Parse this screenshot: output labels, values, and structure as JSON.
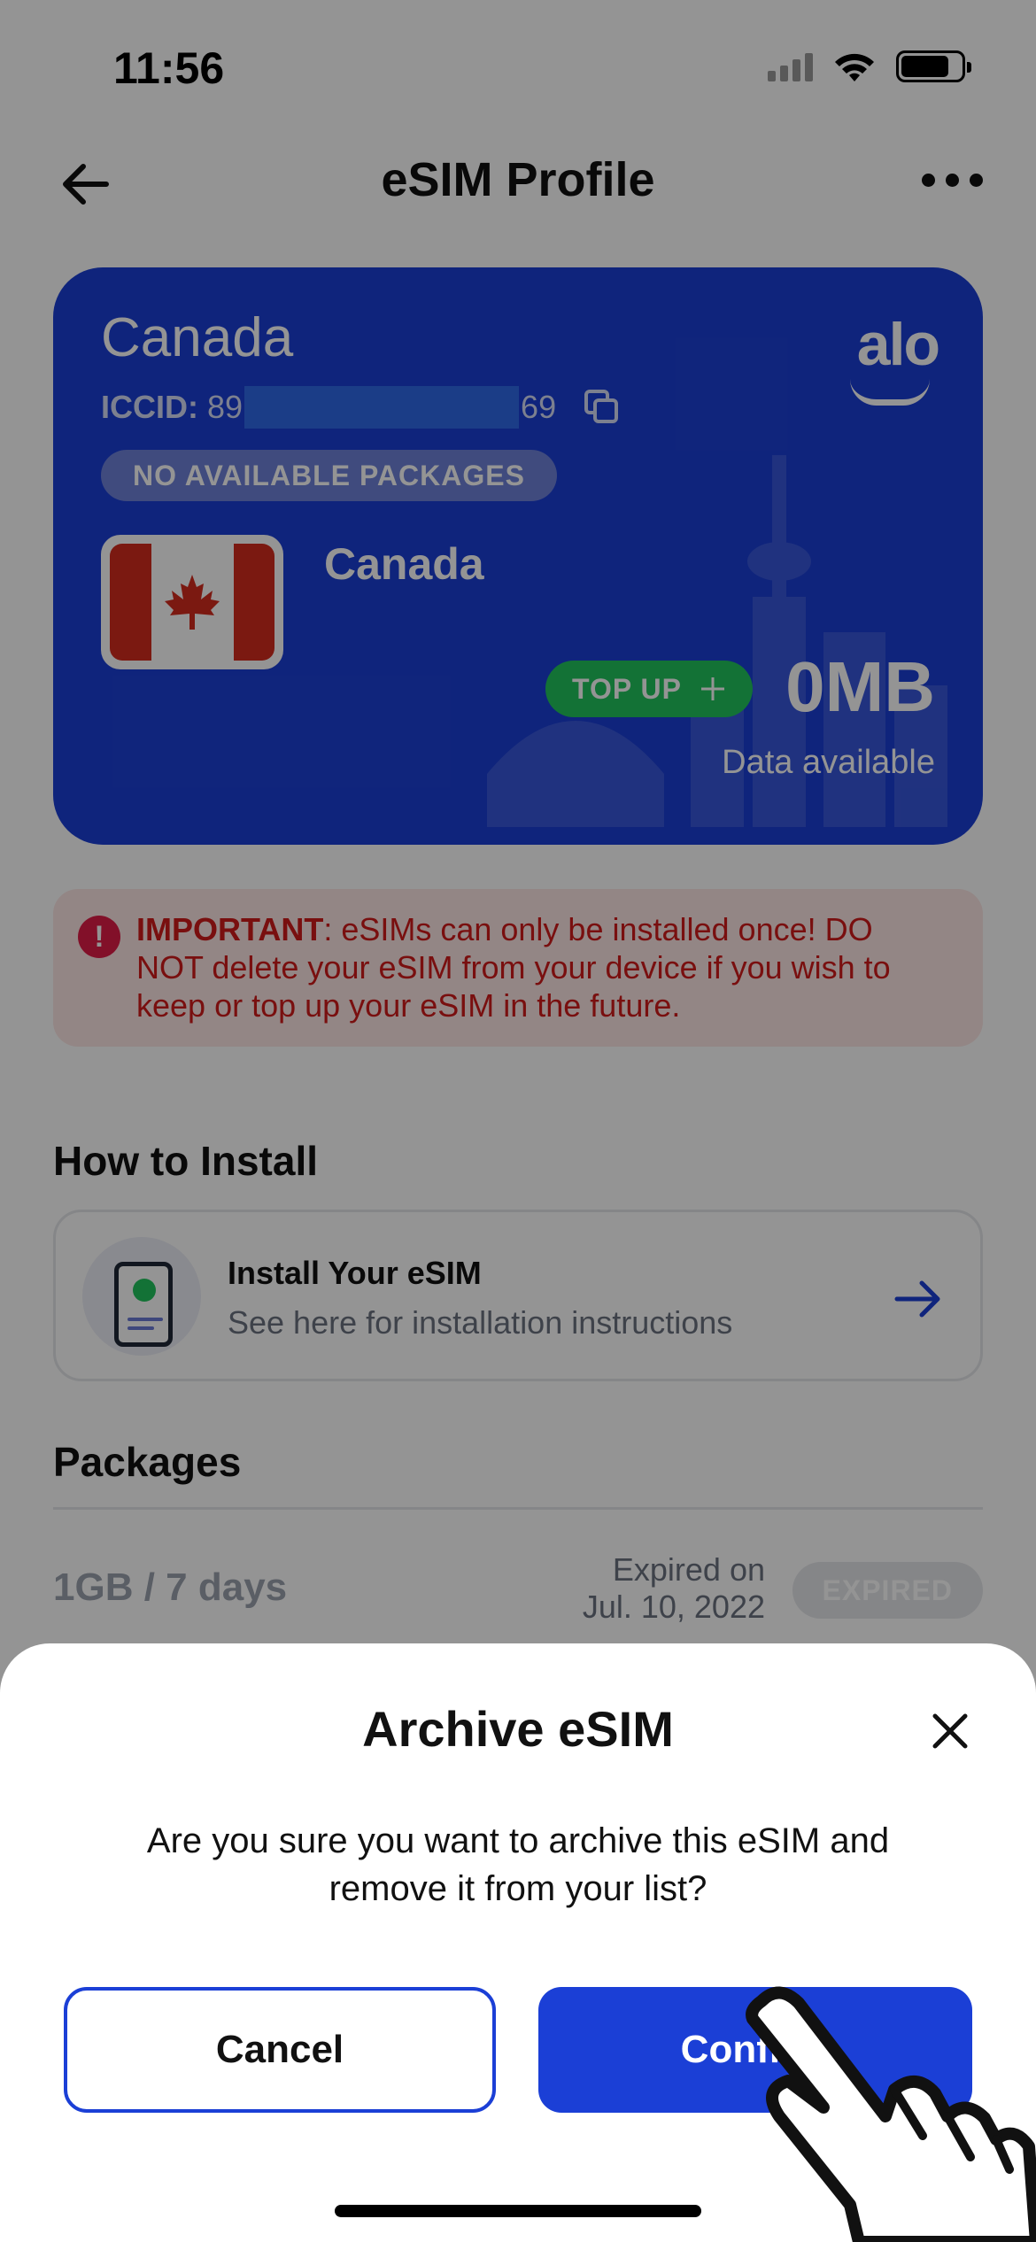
{
  "status_bar": {
    "time": "11:56"
  },
  "header": {
    "title": "eSIM Profile"
  },
  "card": {
    "country": "Canada",
    "brand": "alo",
    "iccid_label": "ICCID:",
    "iccid_prefix": "89",
    "iccid_suffix": "69",
    "package_status": "NO AVAILABLE PACKAGES",
    "flag_country": "Canada",
    "topup_label": "TOP UP",
    "data_amount": "0MB",
    "data_label": "Data available",
    "accent_color": "#1b3fd6"
  },
  "important": {
    "label": "IMPORTANT",
    "text": ": eSIMs can only be installed once! DO NOT delete your eSIM from your device if you wish to keep or top up your eSIM in the future."
  },
  "how_to_install": {
    "section_title": "How to Install",
    "title": "Install Your eSIM",
    "subtitle": "See here for installation instructions"
  },
  "packages": {
    "section_title": "Packages",
    "items": [
      {
        "name": "1GB / 7 days",
        "expiry_line1": "Expired on",
        "expiry_line2": "Jul. 10, 2022",
        "status": "EXPIRED"
      }
    ]
  },
  "dialog": {
    "title": "Archive eSIM",
    "message": "Are you sure you want to archive this eSIM and remove it from your list?",
    "cancel_label": "Cancel",
    "confirm_label": "Confirm"
  }
}
